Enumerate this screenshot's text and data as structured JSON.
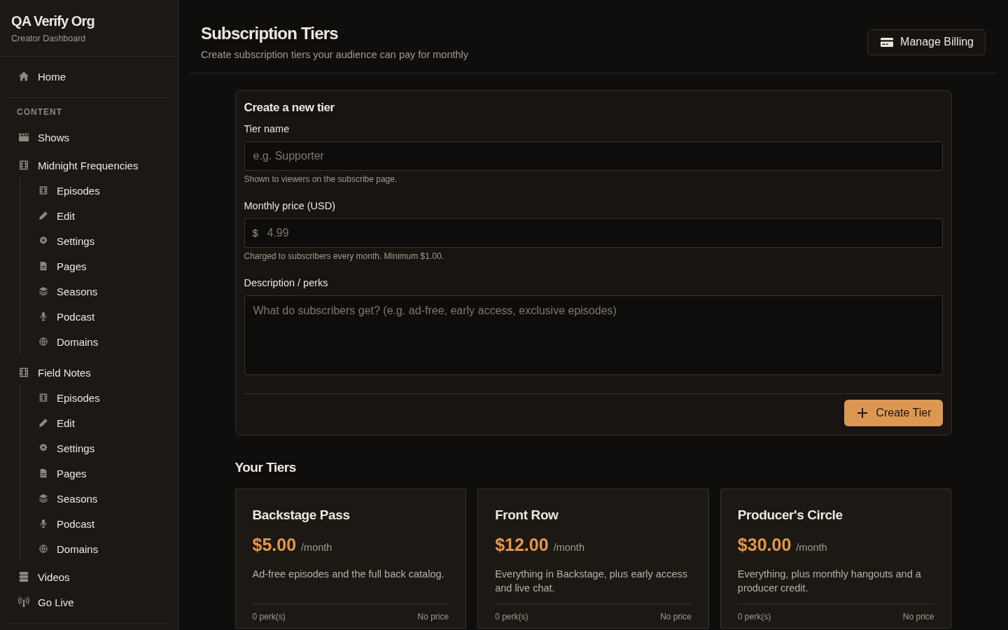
{
  "sidebar": {
    "org_name": "QA Verify Org",
    "org_subtitle": "Creator Dashboard",
    "home": {
      "label": "Home"
    },
    "section_label": "CONTENT",
    "items": [
      {
        "label": "Shows"
      },
      {
        "label": "Midnight Frequencies",
        "children": [
          {
            "label": "Episodes"
          },
          {
            "label": "Edit"
          },
          {
            "label": "Settings"
          },
          {
            "label": "Pages"
          },
          {
            "label": "Seasons"
          },
          {
            "label": "Podcast"
          },
          {
            "label": "Domains"
          }
        ]
      },
      {
        "label": "Field Notes",
        "children": [
          {
            "label": "Episodes"
          },
          {
            "label": "Edit"
          },
          {
            "label": "Settings"
          },
          {
            "label": "Pages"
          },
          {
            "label": "Seasons"
          },
          {
            "label": "Podcast"
          },
          {
            "label": "Domains"
          }
        ]
      },
      {
        "label": "Videos"
      },
      {
        "label": "Go Live"
      }
    ]
  },
  "header": {
    "title": "Subscription Tiers",
    "subtitle": "Create subscription tiers your audience can pay for monthly",
    "button": "Manage Billing"
  },
  "form": {
    "title": "Create a new tier",
    "fields": [
      {
        "kind": "text",
        "label": "Tier name",
        "placeholder": "e.g. Supporter",
        "help": "Shown to viewers on the subscribe page."
      },
      {
        "kind": "currency",
        "label": "Monthly price (USD)",
        "prefix": "$",
        "placeholder": "4.99",
        "help": "Charged to subscribers every month. Minimum $1.00."
      },
      {
        "kind": "textarea",
        "label": "Description / perks",
        "placeholder": "What do subscribers get? (e.g. ad-free, early access, exclusive episodes)"
      }
    ],
    "submit": "Create Tier"
  },
  "tiers_section": {
    "title": "Your Tiers",
    "tiers": [
      {
        "name": "Backstage Pass",
        "price": "$5.00",
        "period": "/month",
        "description": "Ad-free episodes and the full back catalog.",
        "perks": "0 perk(s)",
        "price_note": "No price"
      },
      {
        "name": "Front Row",
        "price": "$12.00",
        "period": "/month",
        "description": "Everything in Backstage, plus early access and live chat.",
        "perks": "0 perk(s)",
        "price_note": "No price"
      },
      {
        "name": "Producer's Circle",
        "price": "$30.00",
        "period": "/month",
        "description": "Everything, plus monthly hangouts and a producer credit.",
        "perks": "0 perk(s)",
        "price_note": "No price"
      }
    ]
  }
}
